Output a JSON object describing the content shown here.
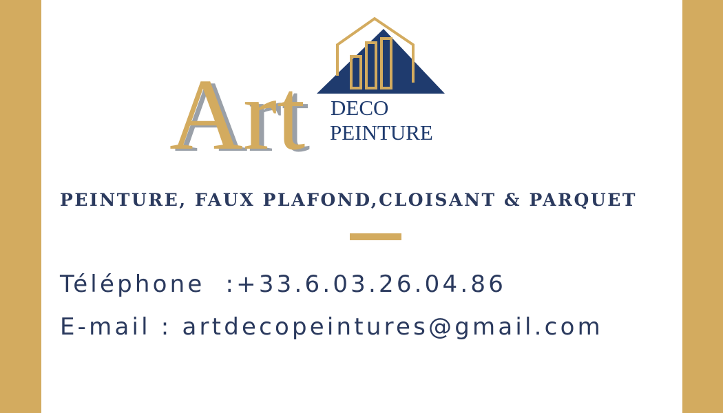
{
  "logo": {
    "art_text": "Art",
    "deco_text": "DECO",
    "peinture_text": "PEINTURE"
  },
  "tagline": "PEINTURE, FAUX PLAFOND,CLOISANT & PARQUET",
  "contact": {
    "phone": "Téléphone  :+33.6.03.26.04.86",
    "email": "E-mail : artdecopeintures@gmail.com"
  },
  "colors": {
    "gold": "#d3ab5f",
    "navy": "#2b3a5e",
    "roof_navy": "#1f3b6e",
    "background": "#ffffff"
  },
  "icons": [
    "house-roof-icon"
  ]
}
